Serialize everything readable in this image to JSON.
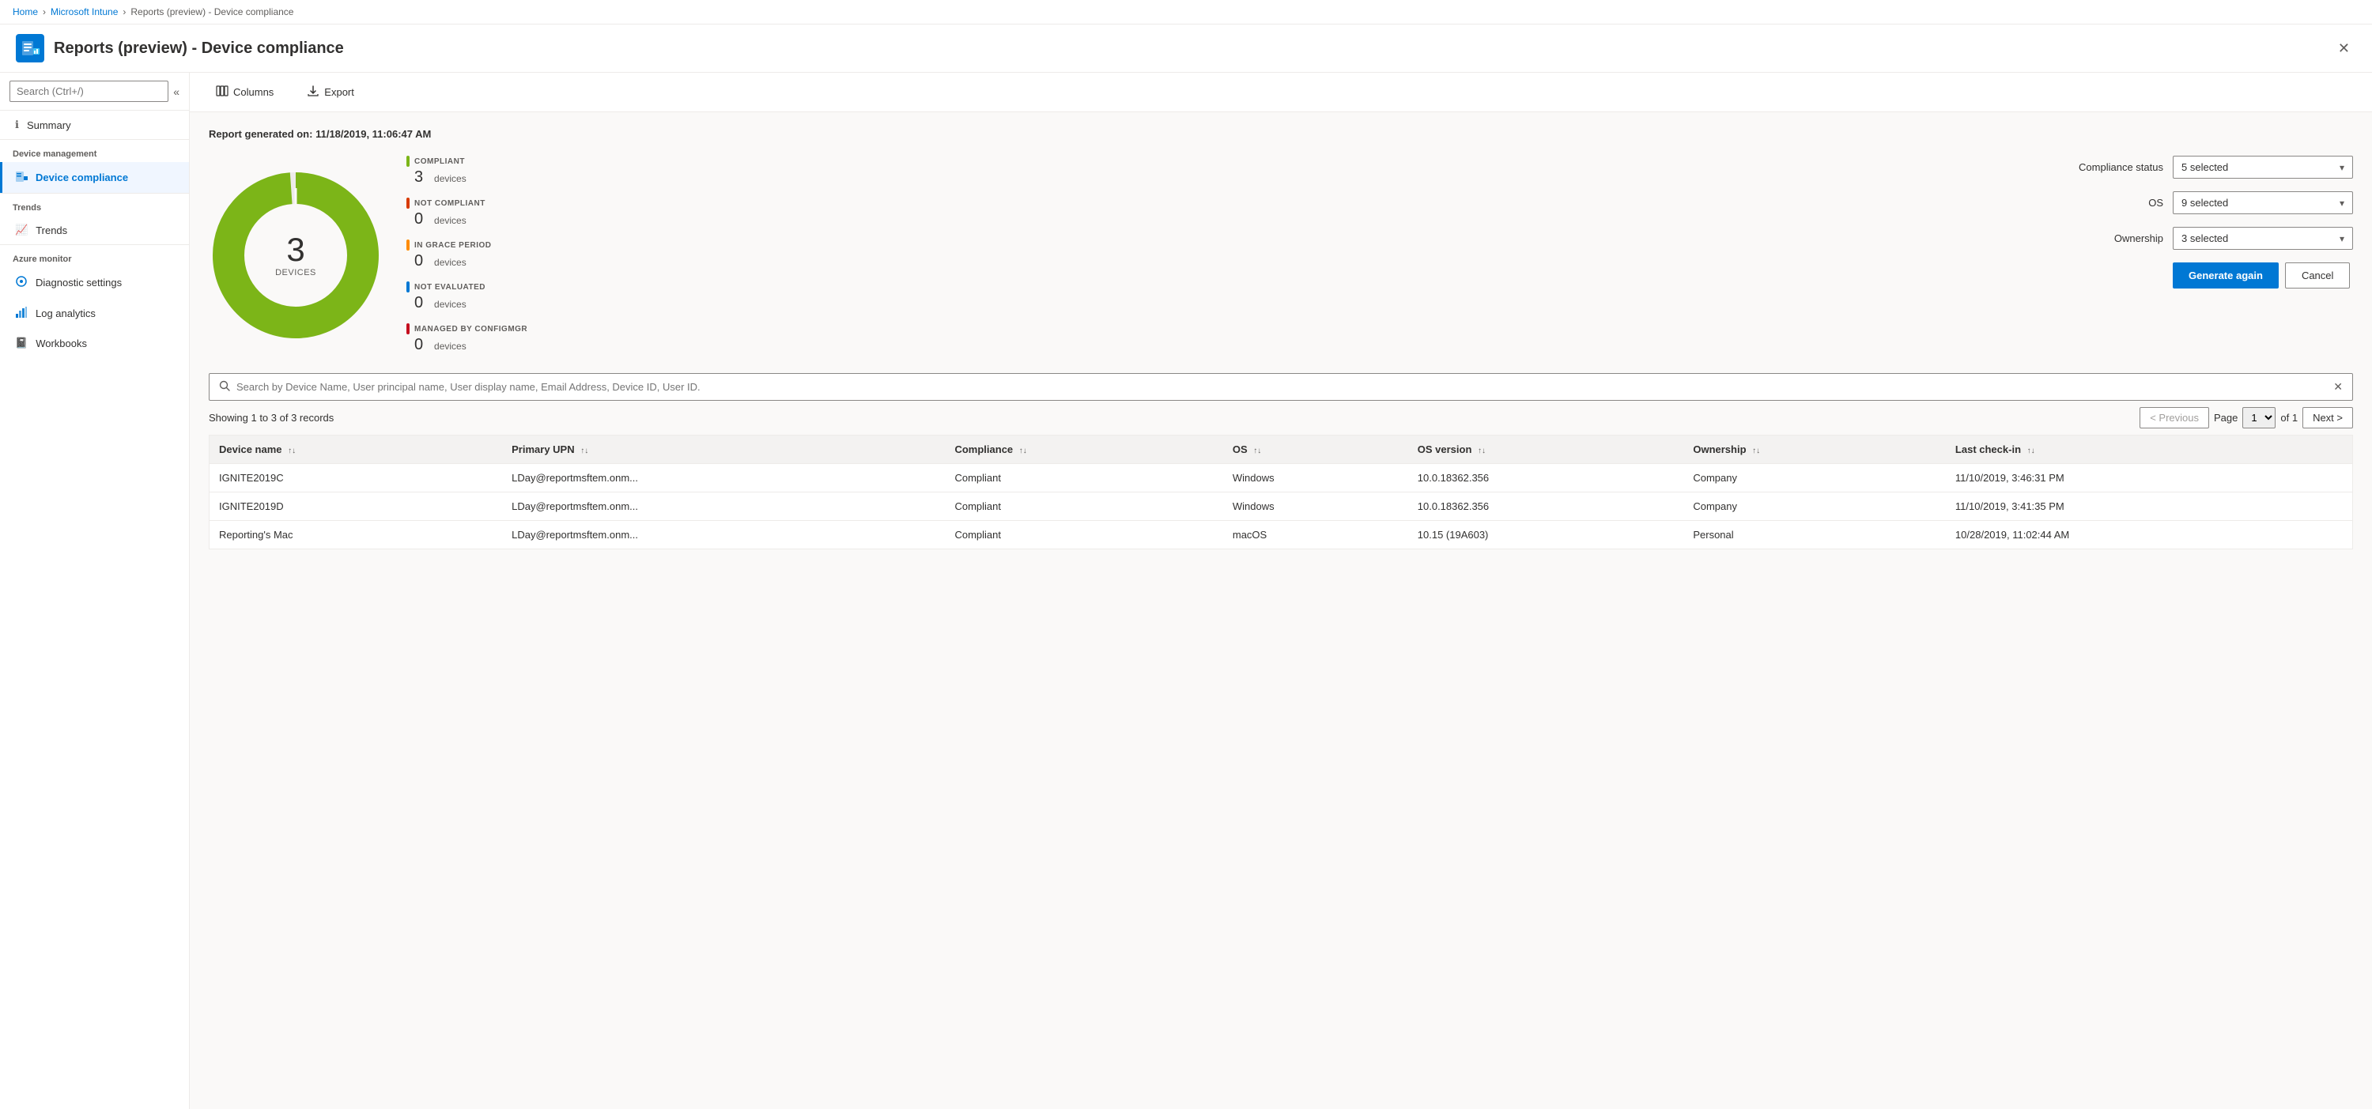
{
  "breadcrumb": {
    "items": [
      "Home",
      "Microsoft Intune",
      "Reports (preview) - Device compliance"
    ],
    "links": [
      true,
      true,
      false
    ]
  },
  "header": {
    "title": "Reports (preview) - Device compliance",
    "icon": "📊"
  },
  "sidebar": {
    "search_placeholder": "Search (Ctrl+/)",
    "collapse_icon": "«",
    "sections": [
      {
        "label": "",
        "items": [
          {
            "id": "summary",
            "label": "Summary",
            "icon": "ℹ",
            "active": false
          }
        ]
      },
      {
        "label": "Device management",
        "items": [
          {
            "id": "device-compliance",
            "label": "Device compliance",
            "icon": "📱",
            "active": true
          }
        ]
      },
      {
        "label": "Trends",
        "items": [
          {
            "id": "trends",
            "label": "Trends",
            "icon": "📈",
            "active": false
          }
        ]
      },
      {
        "label": "Azure monitor",
        "items": [
          {
            "id": "diagnostic-settings",
            "label": "Diagnostic settings",
            "icon": "⚙",
            "active": false
          },
          {
            "id": "log-analytics",
            "label": "Log analytics",
            "icon": "📊",
            "active": false
          },
          {
            "id": "workbooks",
            "label": "Workbooks",
            "icon": "📓",
            "active": false
          }
        ]
      }
    ]
  },
  "toolbar": {
    "columns_label": "Columns",
    "export_label": "Export",
    "columns_icon": "⊞",
    "export_icon": "⬇"
  },
  "report": {
    "generated_label": "Report generated on:",
    "generated_date": "11/18/2019, 11:06:47 AM",
    "donut": {
      "total": "3",
      "total_label": "DEVICES"
    },
    "legend": [
      {
        "id": "compliant",
        "status": "COMPLIANT",
        "color": "#7cb518",
        "count": "3",
        "devices_label": "devices"
      },
      {
        "id": "not-compliant",
        "status": "NOT COMPLIANT",
        "color": "#d83b01",
        "count": "0",
        "devices_label": "devices"
      },
      {
        "id": "grace-period",
        "status": "IN GRACE PERIOD",
        "color": "#ff8c00",
        "count": "0",
        "devices_label": "devices"
      },
      {
        "id": "not-evaluated",
        "status": "NOT EVALUATED",
        "color": "#0078d4",
        "count": "0",
        "devices_label": "devices"
      },
      {
        "id": "configmgr",
        "status": "MANAGED BY CONFIGMGR",
        "color": "#c50f1f",
        "count": "0",
        "devices_label": "devices"
      }
    ],
    "filters": {
      "compliance_status_label": "Compliance status",
      "compliance_status_value": "5 selected",
      "os_label": "OS",
      "os_value": "9 selected",
      "ownership_label": "Ownership",
      "ownership_value": "3 selected",
      "generate_label": "Generate again",
      "cancel_label": "Cancel"
    },
    "search_placeholder": "Search by Device Name, User principal name, User display name, Email Address, Device ID, User ID.",
    "records_count": "Showing 1 to 3 of 3 records",
    "pagination": {
      "previous_label": "< Previous",
      "next_label": "Next >",
      "page_label": "Page",
      "of_label": "of 1",
      "current_page": "1"
    },
    "table": {
      "columns": [
        {
          "id": "device-name",
          "label": "Device name",
          "sortable": true
        },
        {
          "id": "primary-upn",
          "label": "Primary UPN",
          "sortable": true
        },
        {
          "id": "compliance",
          "label": "Compliance",
          "sortable": true
        },
        {
          "id": "os",
          "label": "OS",
          "sortable": true
        },
        {
          "id": "os-version",
          "label": "OS version",
          "sortable": true
        },
        {
          "id": "ownership",
          "label": "Ownership",
          "sortable": true
        },
        {
          "id": "last-checkin",
          "label": "Last check-in",
          "sortable": true
        }
      ],
      "rows": [
        {
          "device_name": "IGNITE2019C",
          "primary_upn": "LDay@reportmsftem.onm...",
          "compliance": "Compliant",
          "os": "Windows",
          "os_version": "10.0.18362.356",
          "ownership": "Company",
          "last_checkin": "11/10/2019, 3:46:31 PM"
        },
        {
          "device_name": "IGNITE2019D",
          "primary_upn": "LDay@reportmsftem.onm...",
          "compliance": "Compliant",
          "os": "Windows",
          "os_version": "10.0.18362.356",
          "ownership": "Company",
          "last_checkin": "11/10/2019, 3:41:35 PM"
        },
        {
          "device_name": "Reporting's Mac",
          "primary_upn": "LDay@reportmsftem.onm...",
          "compliance": "Compliant",
          "os": "macOS",
          "os_version": "10.15 (19A603)",
          "ownership": "Personal",
          "last_checkin": "10/28/2019, 11:02:44 AM"
        }
      ]
    }
  }
}
